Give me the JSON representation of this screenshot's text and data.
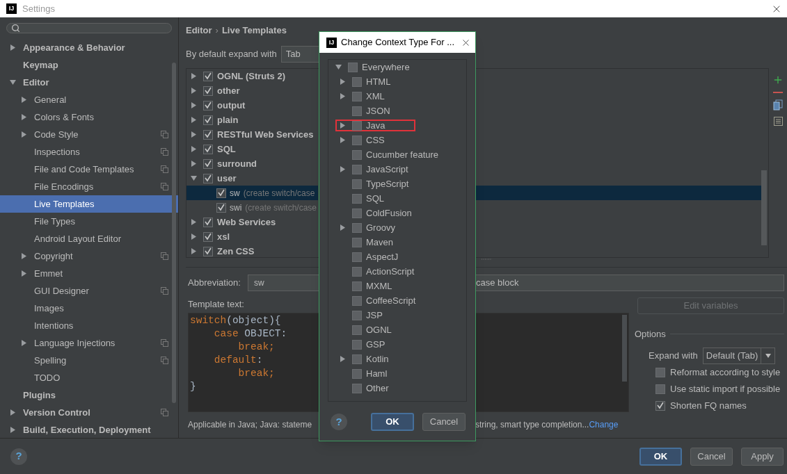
{
  "window": {
    "logo": "IJ",
    "title": "Settings"
  },
  "sidebar": {
    "items": [
      {
        "label": "Appearance & Behavior",
        "expanded": false,
        "per_project": false,
        "selected": false
      },
      {
        "label": "Keymap",
        "per_project": false,
        "selected": false
      },
      {
        "label": "Editor",
        "expanded": true,
        "per_project": false,
        "selected": false,
        "children": [
          {
            "label": "General",
            "expanded": false,
            "per_project": false,
            "selected": false
          },
          {
            "label": "Colors & Fonts",
            "expanded": false,
            "per_project": false,
            "selected": false
          },
          {
            "label": "Code Style",
            "expanded": false,
            "per_project": true,
            "selected": false
          },
          {
            "label": "Inspections",
            "per_project": true,
            "selected": false
          },
          {
            "label": "File and Code Templates",
            "per_project": true,
            "selected": false
          },
          {
            "label": "File Encodings",
            "per_project": true,
            "selected": false
          },
          {
            "label": "Live Templates",
            "per_project": false,
            "selected": true
          },
          {
            "label": "File Types",
            "per_project": false,
            "selected": false
          },
          {
            "label": "Android Layout Editor",
            "per_project": false,
            "selected": false
          },
          {
            "label": "Copyright",
            "expanded": false,
            "per_project": true,
            "selected": false
          },
          {
            "label": "Emmet",
            "expanded": false,
            "per_project": false,
            "selected": false
          },
          {
            "label": "GUI Designer",
            "per_project": true,
            "selected": false
          },
          {
            "label": "Images",
            "per_project": false,
            "selected": false
          },
          {
            "label": "Intentions",
            "per_project": false,
            "selected": false
          },
          {
            "label": "Language Injections",
            "expanded": false,
            "per_project": true,
            "selected": false
          },
          {
            "label": "Spelling",
            "per_project": true,
            "selected": false
          },
          {
            "label": "TODO",
            "per_project": false,
            "selected": false
          }
        ]
      },
      {
        "label": "Plugins",
        "per_project": false,
        "selected": false
      },
      {
        "label": "Version Control",
        "expanded": false,
        "per_project": true,
        "selected": false
      },
      {
        "label": "Build, Execution, Deployment",
        "expanded": false,
        "per_project": false,
        "selected": false
      }
    ]
  },
  "breadcrumb": {
    "parent": "Editor",
    "separator": "›",
    "current": "Live Templates"
  },
  "expand_default": {
    "label": "By default expand with",
    "value": "Tab"
  },
  "template_groups": [
    {
      "label": "OGNL (Struts 2)",
      "checked": true,
      "expanded": false
    },
    {
      "label": "other",
      "checked": true,
      "expanded": false
    },
    {
      "label": "output",
      "checked": true,
      "expanded": false
    },
    {
      "label": "plain",
      "checked": true,
      "expanded": false
    },
    {
      "label": "RESTful Web Services",
      "checked": true,
      "expanded": false
    },
    {
      "label": "SQL",
      "checked": true,
      "expanded": false
    },
    {
      "label": "surround",
      "checked": true,
      "expanded": false
    },
    {
      "label": "user",
      "checked": true,
      "expanded": true,
      "children": [
        {
          "abbreviation": "sw",
          "description": "(create switch/case",
          "checked": true,
          "selected": true
        },
        {
          "abbreviation": "swi",
          "description": "(create switch/case",
          "checked": true,
          "selected": false
        }
      ]
    },
    {
      "label": "Web Services",
      "checked": true,
      "expanded": false
    },
    {
      "label": "xsl",
      "checked": true,
      "expanded": false
    },
    {
      "label": "Zen CSS",
      "checked": true,
      "expanded": false
    }
  ],
  "abbreviation": {
    "label": "Abbreviation:",
    "value": "sw"
  },
  "description": {
    "value": "case block"
  },
  "template_text": {
    "label": "Template text:",
    "lines": [
      [
        {
          "kind": "keyword",
          "text": "switch"
        },
        {
          "kind": "plain",
          "text": "(object){"
        }
      ],
      [
        {
          "kind": "keyword",
          "text": "    case"
        },
        {
          "kind": "plain",
          "text": " OBJECT:"
        }
      ],
      [
        {
          "kind": "keyword",
          "text": "        break;"
        }
      ],
      [
        {
          "kind": "keyword",
          "text": "    default"
        },
        {
          "kind": "plain",
          "text": ":"
        }
      ],
      [
        {
          "kind": "keyword",
          "text": "        break;"
        }
      ],
      [
        {
          "kind": "plain",
          "text": "}"
        }
      ]
    ]
  },
  "edit_variables": {
    "label": "Edit variables",
    "disabled": true
  },
  "options": {
    "title": "Options",
    "expand_with": {
      "label": "Expand with",
      "value": "Default (Tab)"
    },
    "checkboxes": [
      {
        "label": "Reformat according to style",
        "checked": false
      },
      {
        "label": "Use static import if possible",
        "checked": false
      },
      {
        "label": "Shorten FQ names",
        "checked": true
      }
    ]
  },
  "applicable": {
    "text": "Applicable in Java; Java: stateme",
    "text_2": "string, smart type completion...",
    "link": "Change"
  },
  "footer": {
    "help": "?",
    "buttons": [
      {
        "label": "OK",
        "default": true
      },
      {
        "label": "Cancel",
        "default": false
      },
      {
        "label": "Apply",
        "default": false
      }
    ]
  },
  "dialog": {
    "help": "?",
    "logo": "IJ",
    "title": "Change Context Type For ...",
    "items": [
      {
        "label": "Everywhere",
        "checked": false,
        "expanded": true,
        "marked": false,
        "children": [
          {
            "label": "HTML",
            "checked": false,
            "expanded": false,
            "marked": false
          },
          {
            "label": "XML",
            "checked": false,
            "expanded": false,
            "marked": false
          },
          {
            "label": "JSON",
            "checked": false,
            "marked": false
          },
          {
            "label": "Java",
            "checked": false,
            "expanded": false,
            "marked": true
          },
          {
            "label": "CSS",
            "checked": false,
            "expanded": false,
            "marked": false
          },
          {
            "label": "Cucumber feature",
            "checked": false,
            "marked": false
          },
          {
            "label": "JavaScript",
            "checked": false,
            "expanded": false,
            "marked": false
          },
          {
            "label": "TypeScript",
            "checked": false,
            "marked": false
          },
          {
            "label": "SQL",
            "checked": false,
            "marked": false
          },
          {
            "label": "ColdFusion",
            "checked": false,
            "marked": false
          },
          {
            "label": "Groovy",
            "checked": false,
            "expanded": false,
            "marked": false
          },
          {
            "label": "Maven",
            "checked": false,
            "marked": false
          },
          {
            "label": "AspectJ",
            "checked": false,
            "marked": false
          },
          {
            "label": "ActionScript",
            "checked": false,
            "marked": false
          },
          {
            "label": "MXML",
            "checked": false,
            "marked": false
          },
          {
            "label": "CoffeeScript",
            "checked": false,
            "marked": false
          },
          {
            "label": "JSP",
            "checked": false,
            "marked": false
          },
          {
            "label": "OGNL",
            "checked": false,
            "marked": false
          },
          {
            "label": "GSP",
            "checked": false,
            "marked": false
          },
          {
            "label": "Kotlin",
            "checked": false,
            "expanded": false,
            "marked": false
          },
          {
            "label": "Haml",
            "checked": false,
            "marked": false
          },
          {
            "label": "Other",
            "checked": false,
            "marked": false
          }
        ]
      }
    ],
    "buttons": [
      {
        "label": "OK",
        "default": true
      },
      {
        "label": "Cancel",
        "default": false
      }
    ]
  }
}
